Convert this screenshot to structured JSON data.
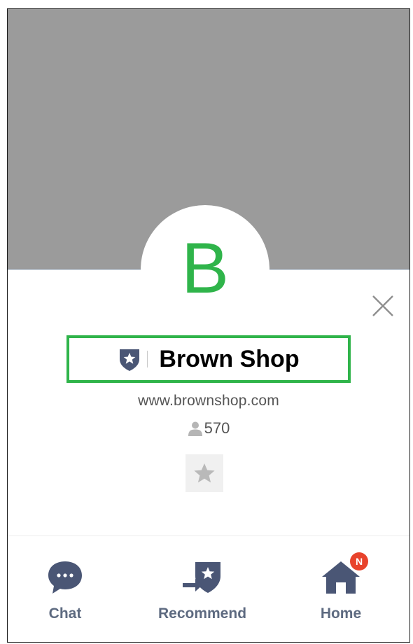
{
  "profile": {
    "avatar_letter": "B",
    "name": "Brown Shop",
    "website": "www.brownshop.com",
    "followers": "570"
  },
  "actions": {
    "chat_label": "Chat",
    "recommend_label": "Recommend",
    "home_label": "Home",
    "home_badge": "N"
  },
  "colors": {
    "accent_green": "#2fb44a",
    "icon_navy": "#4a5675",
    "badge_red": "#e8432c",
    "cover_gray": "#9b9b9b"
  },
  "icons": {
    "close": "close-icon",
    "official": "shield-star-icon",
    "followers": "person-icon",
    "favorite": "star-icon",
    "chat": "chat-bubble-icon",
    "recommend": "recommend-share-icon",
    "home": "home-icon"
  }
}
